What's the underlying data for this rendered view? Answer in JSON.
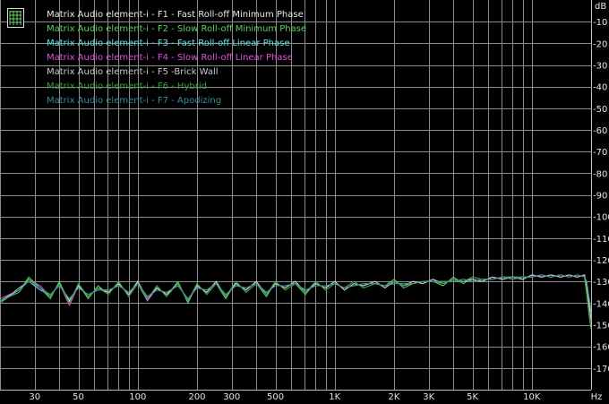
{
  "chart_data": {
    "type": "line",
    "title": "",
    "xlabel": "",
    "ylabel": "",
    "x_unit": "Hz",
    "y_unit": "dB",
    "x_scale": "log",
    "xlim": [
      20,
      20000
    ],
    "ylim": [
      -180,
      0
    ],
    "grid": true,
    "legend_position": "top-left",
    "background": "#000000",
    "grid_color": "#8a8a8a",
    "x_ticks": [
      {
        "value": 30,
        "label": "30"
      },
      {
        "value": 50,
        "label": "50"
      },
      {
        "value": 100,
        "label": "100"
      },
      {
        "value": 200,
        "label": "200"
      },
      {
        "value": 300,
        "label": "300"
      },
      {
        "value": 500,
        "label": "500"
      },
      {
        "value": 1000,
        "label": "1K"
      },
      {
        "value": 2000,
        "label": "2K"
      },
      {
        "value": 3000,
        "label": "3K"
      },
      {
        "value": 5000,
        "label": "5K"
      },
      {
        "value": 10000,
        "label": "10K"
      }
    ],
    "y_ticks": [
      {
        "value": -10,
        "label": "-10"
      },
      {
        "value": -20,
        "label": "-20"
      },
      {
        "value": -30,
        "label": "-30"
      },
      {
        "value": -40,
        "label": "-40"
      },
      {
        "value": -50,
        "label": "-50"
      },
      {
        "value": -60,
        "label": "-60"
      },
      {
        "value": -70,
        "label": "-70"
      },
      {
        "value": -80,
        "label": "-80"
      },
      {
        "value": -90,
        "label": "-90"
      },
      {
        "value": -100,
        "label": "-100"
      },
      {
        "value": -110,
        "label": "-110"
      },
      {
        "value": -120,
        "label": "-120"
      },
      {
        "value": -130,
        "label": "-130"
      },
      {
        "value": -140,
        "label": "-140"
      },
      {
        "value": -150,
        "label": "-150"
      },
      {
        "value": -160,
        "label": "-160"
      },
      {
        "value": -170,
        "label": "-170"
      }
    ],
    "x": [
      20,
      25,
      28,
      32,
      36,
      40,
      45,
      50,
      56,
      63,
      71,
      80,
      90,
      100,
      112,
      125,
      140,
      160,
      180,
      200,
      224,
      250,
      280,
      315,
      355,
      400,
      450,
      500,
      560,
      630,
      710,
      800,
      900,
      1000,
      1120,
      1250,
      1400,
      1600,
      1800,
      2000,
      2240,
      2500,
      2800,
      3150,
      3550,
      4000,
      4500,
      5000,
      5600,
      6300,
      7100,
      8000,
      9000,
      10000,
      11200,
      12500,
      14000,
      15500,
      17000,
      18500,
      19000,
      19500,
      20000
    ],
    "series": [
      {
        "name": "Matrix Audio element-i - F1 - Fast Roll-off Minimum Phase",
        "color": "#e8e8e8",
        "values": [
          -139,
          -134,
          -129,
          -133,
          -137,
          -131,
          -139,
          -132,
          -137,
          -133,
          -135,
          -131,
          -136,
          -130,
          -138,
          -133,
          -136,
          -131,
          -139,
          -132,
          -135,
          -130,
          -137,
          -131,
          -134,
          -130,
          -136,
          -131,
          -133,
          -130,
          -135,
          -131,
          -133,
          -130,
          -134,
          -131,
          -132,
          -130,
          -133,
          -130,
          -132,
          -130,
          -131,
          -129,
          -131,
          -129,
          -130,
          -129,
          -130,
          -128,
          -129,
          -128,
          -129,
          -127,
          -128,
          -127,
          -128,
          -127,
          -128,
          -127,
          -133,
          -141,
          -148
        ]
      },
      {
        "name": "Matrix Audio element-i - F2 - Slow Roll-off Minimum Phase",
        "color": "#5ad35a",
        "values": [
          -139,
          -135,
          -128,
          -133,
          -138,
          -130,
          -140,
          -131,
          -138,
          -132,
          -136,
          -130,
          -137,
          -131,
          -139,
          -132,
          -137,
          -130,
          -140,
          -131,
          -136,
          -131,
          -138,
          -130,
          -135,
          -131,
          -137,
          -130,
          -134,
          -131,
          -136,
          -130,
          -134,
          -131,
          -133,
          -130,
          -133,
          -131,
          -132,
          -129,
          -133,
          -131,
          -130,
          -130,
          -132,
          -128,
          -131,
          -128,
          -129,
          -129,
          -128,
          -128,
          -128,
          -128,
          -127,
          -128,
          -127,
          -128,
          -127,
          -128,
          -136,
          -145,
          -152
        ]
      },
      {
        "name": "Matrix Audio element-i - F3 - Fast Roll-off Linear Phase",
        "color": "#66e0e0",
        "values": [
          -140,
          -133,
          -130,
          -134,
          -136,
          -132,
          -138,
          -133,
          -136,
          -134,
          -134,
          -132,
          -135,
          -131,
          -137,
          -134,
          -135,
          -132,
          -138,
          -133,
          -134,
          -131,
          -136,
          -132,
          -133,
          -131,
          -135,
          -132,
          -132,
          -131,
          -134,
          -132,
          -132,
          -131,
          -133,
          -132,
          -131,
          -131,
          -132,
          -131,
          -131,
          -131,
          -130,
          -130,
          -130,
          -130,
          -129,
          -130,
          -129,
          -129,
          -128,
          -129,
          -128,
          -128,
          -127,
          -128,
          -127,
          -128,
          -127,
          -128,
          -131,
          -138,
          -144
        ]
      },
      {
        "name": "Matrix Audio element-i - F4 - Slow Roll-off Linear Phase",
        "color": "#e050e0",
        "values": [
          -138,
          -134,
          -129,
          -132,
          -137,
          -131,
          -141,
          -132,
          -137,
          -133,
          -135,
          -131,
          -136,
          -130,
          -139,
          -133,
          -136,
          -131,
          -139,
          -132,
          -135,
          -130,
          -137,
          -131,
          -134,
          -130,
          -136,
          -131,
          -133,
          -130,
          -135,
          -131,
          -133,
          -130,
          -134,
          -131,
          -132,
          -130,
          -133,
          -130,
          -132,
          -130,
          -131,
          -129,
          -131,
          -129,
          -130,
          -129,
          -130,
          -128,
          -129,
          -128,
          -129,
          -127,
          -128,
          -127,
          -128,
          -127,
          -128,
          -127,
          -134,
          -142,
          -149
        ]
      },
      {
        "name": "Matrix Audio element-i - F5 -Brick Wall",
        "color": "#c8c8c8",
        "values": [
          -139,
          -134,
          -129,
          -133,
          -137,
          -131,
          -139,
          -132,
          -137,
          -133,
          -135,
          -131,
          -136,
          -130,
          -138,
          -133,
          -136,
          -131,
          -139,
          -132,
          -135,
          -130,
          -137,
          -131,
          -134,
          -130,
          -136,
          -131,
          -133,
          -130,
          -135,
          -131,
          -133,
          -130,
          -134,
          -131,
          -132,
          -130,
          -133,
          -130,
          -132,
          -130,
          -131,
          -129,
          -131,
          -129,
          -130,
          -129,
          -130,
          -128,
          -129,
          -128,
          -129,
          -127,
          -128,
          -127,
          -128,
          -127,
          -128,
          -127,
          -132,
          -140,
          -147
        ]
      },
      {
        "name": "Matrix Audio element-i - F6 - Hybrid",
        "color": "#3aa03a",
        "values": [
          -139,
          -135,
          -129,
          -133,
          -137,
          -131,
          -140,
          -131,
          -137,
          -133,
          -136,
          -130,
          -137,
          -131,
          -138,
          -132,
          -137,
          -131,
          -139,
          -131,
          -136,
          -131,
          -137,
          -130,
          -135,
          -131,
          -136,
          -130,
          -134,
          -131,
          -135,
          -130,
          -134,
          -131,
          -133,
          -130,
          -133,
          -131,
          -132,
          -130,
          -132,
          -131,
          -130,
          -130,
          -131,
          -129,
          -130,
          -128,
          -129,
          -129,
          -128,
          -128,
          -128,
          -128,
          -127,
          -128,
          -127,
          -128,
          -127,
          -128,
          -135,
          -144,
          -150
        ]
      },
      {
        "name": "Matrix Audio element-i - F7 - Apodizing",
        "color": "#3a8c9a",
        "values": [
          -140,
          -134,
          -130,
          -133,
          -136,
          -132,
          -138,
          -133,
          -136,
          -134,
          -134,
          -132,
          -135,
          -131,
          -137,
          -134,
          -135,
          -132,
          -138,
          -133,
          -134,
          -131,
          -136,
          -132,
          -133,
          -131,
          -135,
          -132,
          -132,
          -131,
          -134,
          -132,
          -132,
          -131,
          -133,
          -132,
          -131,
          -131,
          -132,
          -131,
          -131,
          -131,
          -130,
          -130,
          -130,
          -130,
          -129,
          -130,
          -129,
          -129,
          -128,
          -129,
          -128,
          -128,
          -127,
          -128,
          -127,
          -128,
          -127,
          -128,
          -130,
          -137,
          -143
        ]
      }
    ]
  }
}
